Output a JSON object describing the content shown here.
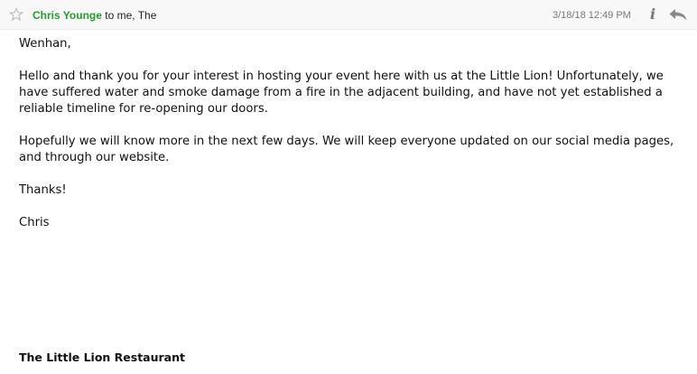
{
  "header": {
    "star_icon": "star-outline-icon",
    "sender_name": "Chris Younge",
    "recipients": "to me, The",
    "date": "3/18/18 12:49 PM",
    "info_icon": "info-icon",
    "info_glyph": "i",
    "reply_icon": "reply-arrow-icon"
  },
  "message": {
    "greeting": "Wenhan,",
    "paragraphs": [
      "Hello and thank you for your interest in hosting your event here with us at the Little Lion!  Unfortunately, we have suffered water and smoke damage from a fire in the adjacent building, and have not yet established a reliable timeline for re-opening our doors.",
      "Hopefully we will know more in the next few days.  We will keep everyone updated on our social media pages, and through our website."
    ],
    "signoff": "Thanks!",
    "signature_name": "Chris",
    "organization": "The Little Lion Restaurant"
  },
  "colors": {
    "sender": "#249a2f",
    "date": "#777777",
    "header_background": "#f8f8f8"
  }
}
